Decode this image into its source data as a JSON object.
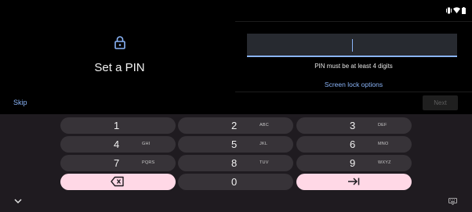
{
  "status_bar": {
    "icons": [
      "vibrate-icon",
      "wifi-icon",
      "battery-icon"
    ]
  },
  "setup": {
    "title": "Set a PIN",
    "skip_label": "Skip",
    "pin_value": "",
    "hint": "PIN must be at least 4 digits",
    "screen_lock_options_label": "Screen lock options",
    "next_label": "Next"
  },
  "keyboard": {
    "keys": [
      {
        "digit": "1",
        "letters": ""
      },
      {
        "digit": "2",
        "letters": "ABC"
      },
      {
        "digit": "3",
        "letters": "DEF"
      },
      {
        "digit": "4",
        "letters": "GHI"
      },
      {
        "digit": "5",
        "letters": "JKL"
      },
      {
        "digit": "6",
        "letters": "MNO"
      },
      {
        "digit": "7",
        "letters": "PQRS"
      },
      {
        "digit": "8",
        "letters": "TUV"
      },
      {
        "digit": "9",
        "letters": "WXYZ"
      },
      {
        "digit": "0",
        "letters": ""
      }
    ],
    "backspace_icon": "backspace-icon",
    "enter_icon": "tab-enter-icon",
    "collapse_icon": "chevron-down-icon",
    "switch_icon": "keyboard-icon"
  },
  "colors": {
    "accent": "#8ab4f8",
    "action_key": "#ffd8e6",
    "key": "#373338",
    "keyboard_bg": "#1f1b20"
  }
}
